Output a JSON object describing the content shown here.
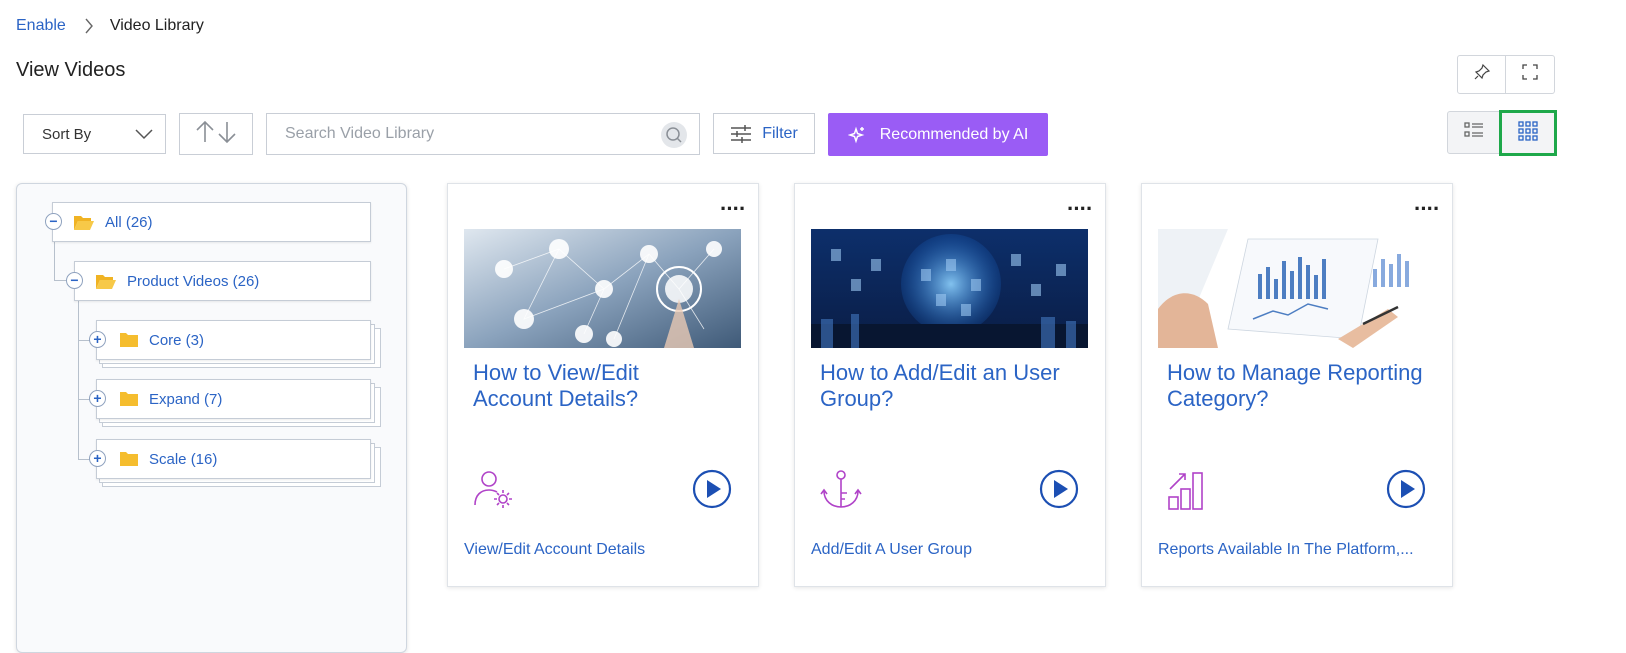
{
  "breadcrumb": {
    "root": "Enable",
    "current": "Video Library"
  },
  "page_title": "View Videos",
  "toolbar": {
    "sort_label": "Sort By",
    "search_placeholder": "Search Video Library",
    "filter_label": "Filter",
    "ai_label": "Recommended by AI"
  },
  "tree": {
    "all": "All (26)",
    "product": "Product Videos (26)",
    "children": [
      "Core (3)",
      "Expand (7)",
      "Scale (16)"
    ]
  },
  "cards": [
    {
      "title": "How to View/Edit Account Details?",
      "link": "View/Edit Account Details",
      "icon": "user-settings-icon"
    },
    {
      "title": "How to Add/Edit an User Group?",
      "link": "Add/Edit A User Group",
      "icon": "anchor-icon"
    },
    {
      "title": "How to Manage Reporting Category?",
      "link": "Reports Available In The Platform,...",
      "icon": "bar-chart-icon"
    }
  ],
  "colors": {
    "accent": "#2b64c5",
    "ai_button": "#9a5cf5",
    "selected_view_border": "#1ea84a",
    "icon_purple": "#b043c8"
  }
}
